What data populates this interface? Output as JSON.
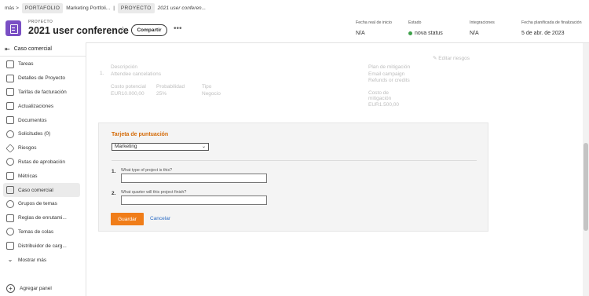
{
  "breadcrumb": {
    "more": "más >",
    "portfolio_chip": "PORTAFOLIO",
    "portfolio_name": "Marketing Portfoli...",
    "separator": "|",
    "project_chip": "PROYECTO",
    "project_name": "2021 user conferen..."
  },
  "header": {
    "eyebrow": "PROYECTO",
    "title": "2021 user conference",
    "share_label": "Compartir",
    "more_label": "•••",
    "meta": [
      {
        "label": "Fecha real de inicio",
        "value": "N/A"
      },
      {
        "label": "Estado",
        "value": "nova status"
      },
      {
        "label": "Integraciones",
        "value": "N/A"
      },
      {
        "label": "Fecha planificada de finalización",
        "value": "5 de abr. de 2023"
      }
    ],
    "status_color": "#3ea04a",
    "icon_color": "#7a4fc4"
  },
  "sidebar": {
    "header": "Caso comercial",
    "items": [
      {
        "label": "Tareas",
        "icon": "task-icon"
      },
      {
        "label": "Detalles de Proyecto",
        "icon": "details-icon"
      },
      {
        "label": "Tarifas de facturación",
        "icon": "billing-icon"
      },
      {
        "label": "Actualizaciones",
        "icon": "updates-icon"
      },
      {
        "label": "Documentos",
        "icon": "documents-icon"
      },
      {
        "label": "Solicitudes (0)",
        "icon": "requests-icon"
      },
      {
        "label": "Riesgos",
        "icon": "risks-icon"
      },
      {
        "label": "Rutas de aprobación",
        "icon": "approval-icon"
      },
      {
        "label": "Métricas",
        "icon": "metrics-icon"
      },
      {
        "label": "Caso comercial",
        "icon": "business-case-icon"
      },
      {
        "label": "Grupos de temas",
        "icon": "topic-groups-icon"
      },
      {
        "label": "Reglas de enrutami...",
        "icon": "routing-rules-icon"
      },
      {
        "label": "Temas de colas",
        "icon": "queue-topics-icon"
      },
      {
        "label": "Distribuidor de carg...",
        "icon": "workload-icon"
      },
      {
        "label": "Mostrar más",
        "icon": "chevron-down-icon"
      }
    ],
    "add_panel": "Agregar panel"
  },
  "risk_section": {
    "number": "1.",
    "edit_link": "Editar riesgos",
    "description_label": "Descripción",
    "description_value": "Attendee cancelations",
    "potential_cost_label": "Costo potencial",
    "potential_cost_value": "EUR10.000,00",
    "probability_label": "Probabilidad",
    "probability_value": "25%",
    "type_label": "Tipo",
    "type_value": "Negocio",
    "mitigation_plan_label": "Plan de mitigación",
    "mitigation_plan_value_1": "Email campaign",
    "mitigation_plan_value_2": "Refunds or credits",
    "mitigation_cost_label_1": "Costo de",
    "mitigation_cost_label_2": "mitigación",
    "mitigation_cost_value": "EUR1.500,00"
  },
  "scorecard": {
    "title": "Tarjeta de puntuación",
    "selected": "Marketing",
    "questions": [
      {
        "number": "1.",
        "text": "What type of project is this?",
        "value": ""
      },
      {
        "number": "2.",
        "text": "What quarter will this project finish?",
        "value": ""
      }
    ],
    "save_label": "Guardar",
    "cancel_label": "Cancelar",
    "accent_color": "#f07d19"
  }
}
